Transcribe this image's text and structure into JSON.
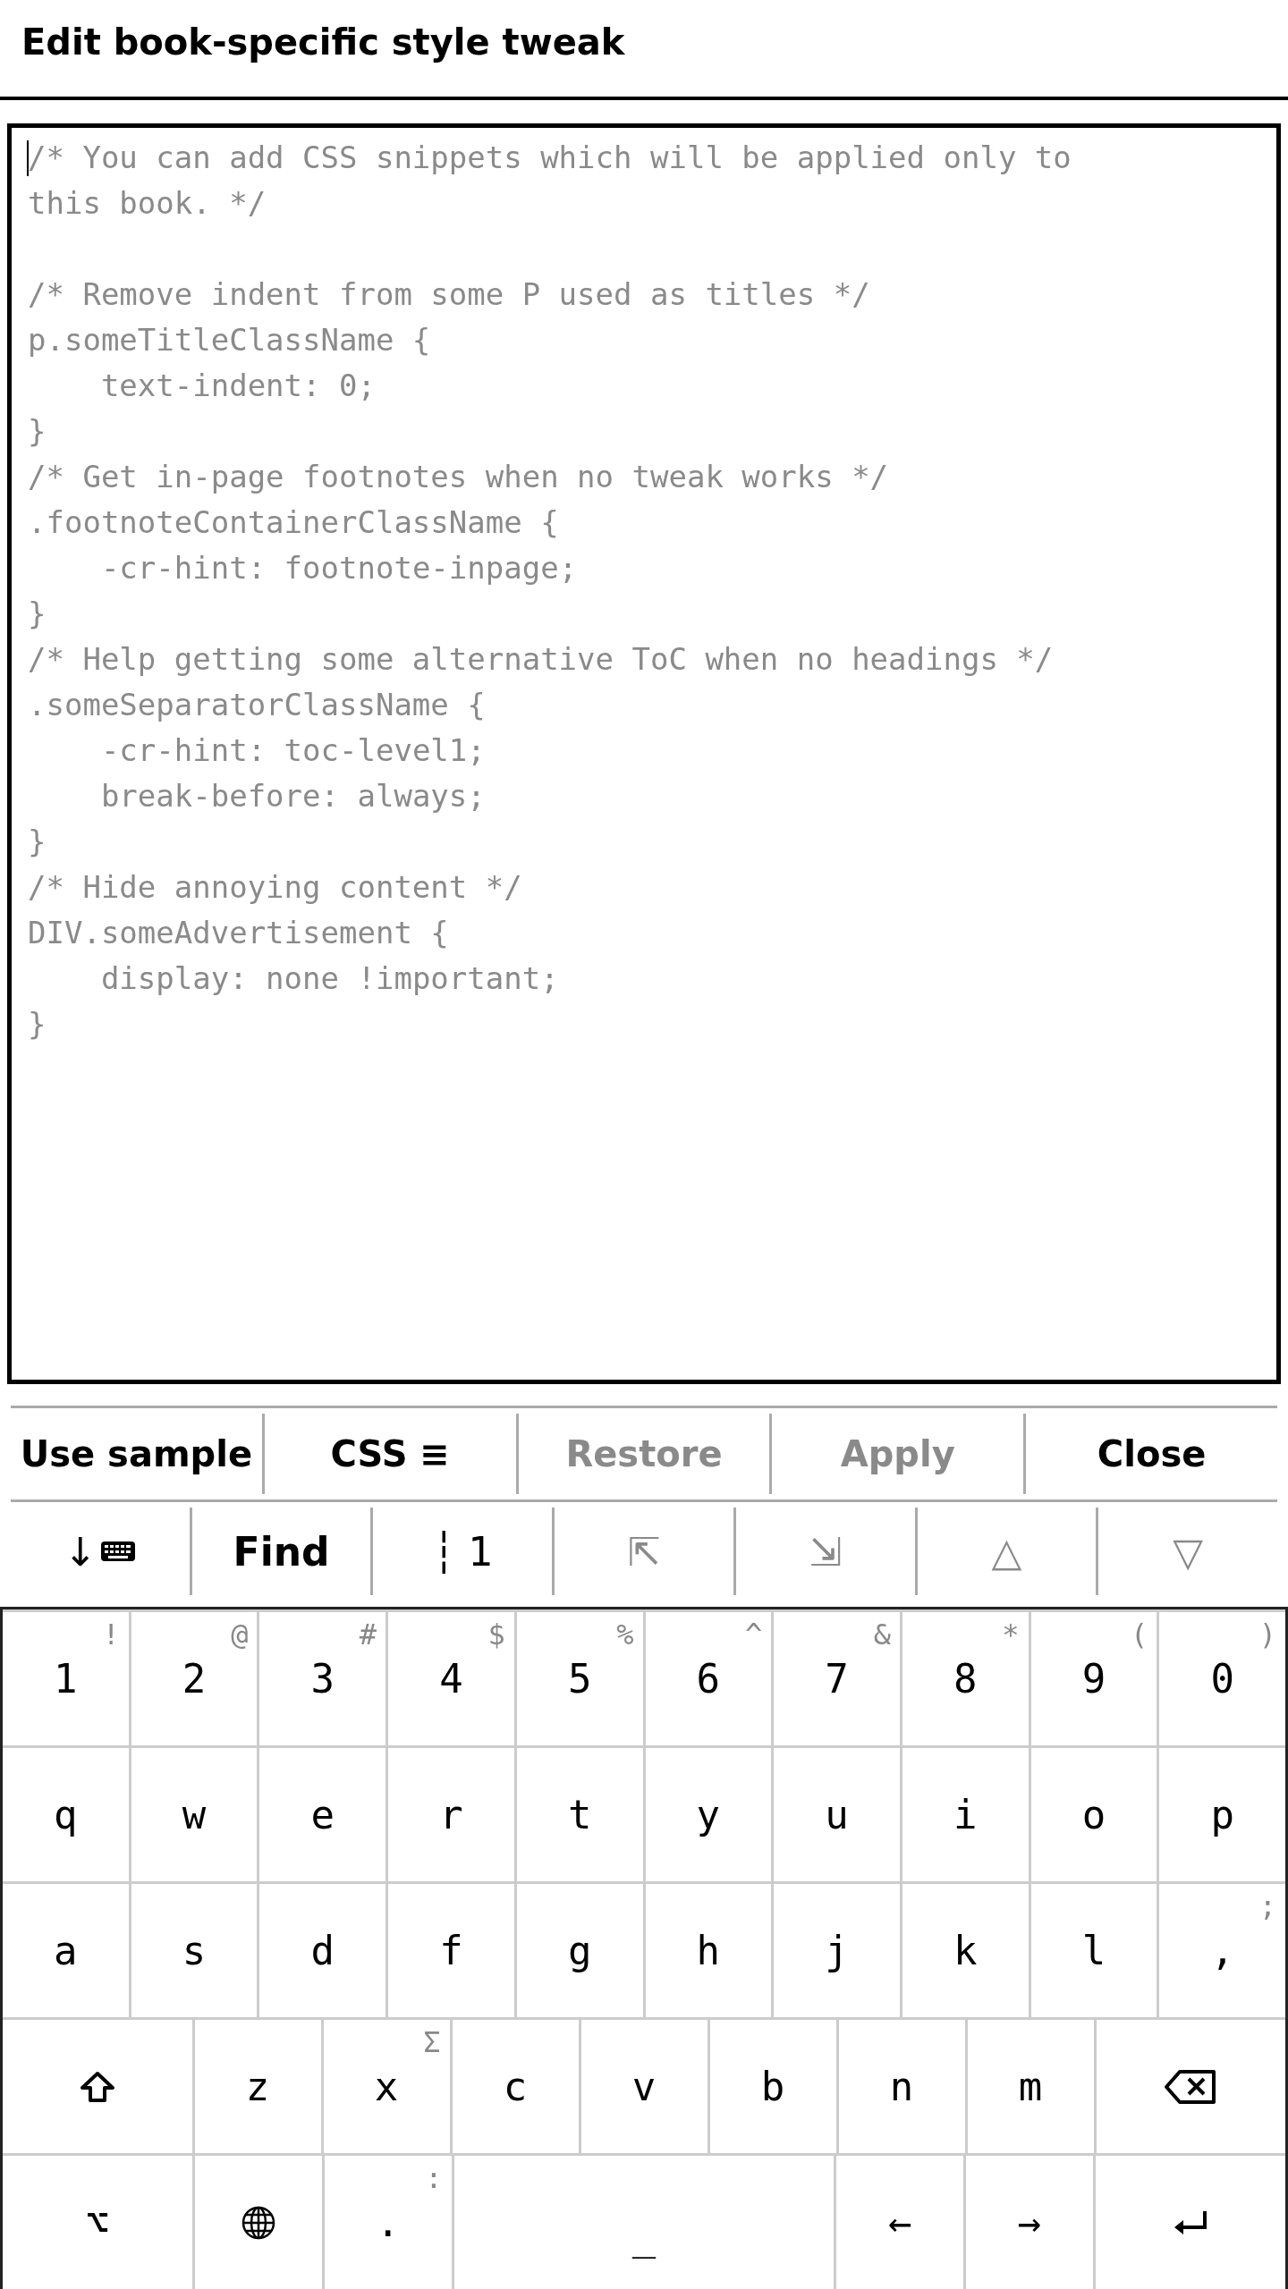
{
  "window": {
    "title": "Edit book-specific style tweak"
  },
  "editor": {
    "focused": true,
    "placeholder": "/* You can add CSS snippets which will be applied only to\nthis book. */\n\n/* Remove indent from some P used as titles */\np.someTitleClassName {\n    text-indent: 0;\n}\n/* Get in-page footnotes when no tweak works */\n.footnoteContainerClassName {\n    -cr-hint: footnote-inpage;\n}\n/* Help getting some alternative ToC when no headings */\n.someSeparatorClassName {\n    -cr-hint: toc-level1;\n    break-before: always;\n}\n/* Hide annoying content */\nDIV.someAdvertisement {\n    display: none !important;\n}"
  },
  "actions": [
    {
      "label": "Use sample",
      "disabled": false
    },
    {
      "label": "CSS ≡",
      "disabled": false
    },
    {
      "label": "Restore",
      "disabled": true
    },
    {
      "label": "Apply",
      "disabled": true
    },
    {
      "label": "Close",
      "disabled": false
    }
  ],
  "nav_bar": [
    {
      "kind": "hide_keyboard",
      "label": "↓"
    },
    {
      "kind": "bold",
      "label": "Find",
      "disabled": false
    },
    {
      "kind": "plain",
      "label": "┆ 1",
      "disabled": false
    },
    {
      "kind": "plain",
      "label": "⇱",
      "disabled": true
    },
    {
      "kind": "plain",
      "label": "⇲",
      "disabled": true
    },
    {
      "kind": "plain",
      "label": "△",
      "disabled": true
    },
    {
      "kind": "plain",
      "label": "▽",
      "disabled": true
    }
  ],
  "keyboard": {
    "rows": [
      [
        {
          "kind": "char",
          "label": "1",
          "alt": "!"
        },
        {
          "kind": "char",
          "label": "2",
          "alt": "@"
        },
        {
          "kind": "char",
          "label": "3",
          "alt": "#"
        },
        {
          "kind": "char",
          "label": "4",
          "alt": "$"
        },
        {
          "kind": "char",
          "label": "5",
          "alt": "%"
        },
        {
          "kind": "char",
          "label": "6",
          "alt": "^"
        },
        {
          "kind": "char",
          "label": "7",
          "alt": "&"
        },
        {
          "kind": "char",
          "label": "8",
          "alt": "*"
        },
        {
          "kind": "char",
          "label": "9",
          "alt": "("
        },
        {
          "kind": "char",
          "label": "0",
          "alt": ")"
        }
      ],
      [
        {
          "kind": "char",
          "label": "q"
        },
        {
          "kind": "char",
          "label": "w"
        },
        {
          "kind": "char",
          "label": "e"
        },
        {
          "kind": "char",
          "label": "r"
        },
        {
          "kind": "char",
          "label": "t"
        },
        {
          "kind": "char",
          "label": "y"
        },
        {
          "kind": "char",
          "label": "u"
        },
        {
          "kind": "char",
          "label": "i"
        },
        {
          "kind": "char",
          "label": "o"
        },
        {
          "kind": "char",
          "label": "p"
        }
      ],
      [
        {
          "kind": "char",
          "label": "a"
        },
        {
          "kind": "char",
          "label": "s"
        },
        {
          "kind": "char",
          "label": "d"
        },
        {
          "kind": "char",
          "label": "f"
        },
        {
          "kind": "char",
          "label": "g"
        },
        {
          "kind": "char",
          "label": "h"
        },
        {
          "kind": "char",
          "label": "j"
        },
        {
          "kind": "char",
          "label": "k"
        },
        {
          "kind": "char",
          "label": "l"
        },
        {
          "kind": "char",
          "label": ",",
          "alt": ";"
        }
      ],
      [
        {
          "kind": "shift"
        },
        {
          "kind": "char",
          "label": "z"
        },
        {
          "kind": "char",
          "label": "x",
          "alt": "Σ"
        },
        {
          "kind": "char",
          "label": "c"
        },
        {
          "kind": "char",
          "label": "v"
        },
        {
          "kind": "char",
          "label": "b"
        },
        {
          "kind": "char",
          "label": "n"
        },
        {
          "kind": "char",
          "label": "m"
        },
        {
          "kind": "backspace"
        }
      ],
      [
        {
          "kind": "wide",
          "label": "⌥"
        },
        {
          "kind": "globe"
        },
        {
          "kind": "char",
          "label": ".",
          "alt": ":"
        },
        {
          "kind": "space",
          "label": "_"
        },
        {
          "kind": "char",
          "label": "←"
        },
        {
          "kind": "char",
          "label": "→"
        },
        {
          "kind": "enter"
        }
      ]
    ]
  }
}
